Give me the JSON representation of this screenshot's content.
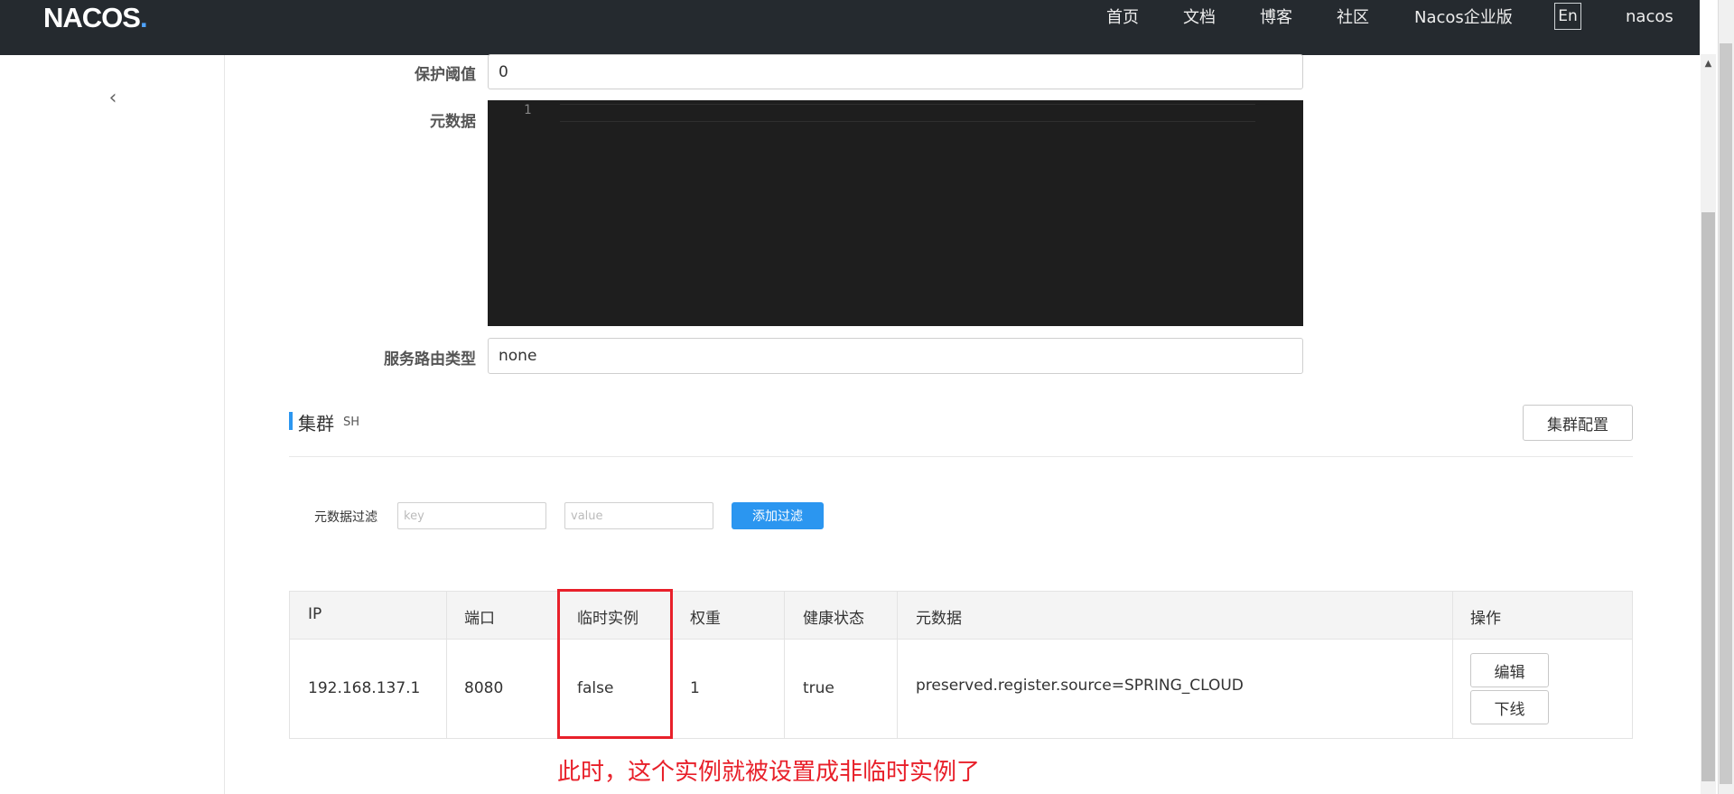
{
  "header": {
    "logo_text": "NACOS",
    "logo_dot": ".",
    "nav": [
      "首页",
      "文档",
      "博客",
      "社区",
      "Nacos企业版"
    ],
    "language_button": "En",
    "user": "nacos"
  },
  "service_form": {
    "protect_threshold_label": "保护阈值",
    "protect_threshold_value": "0",
    "metadata_label": "元数据",
    "editor_line_number": "1",
    "routing_type_label": "服务路由类型",
    "routing_type_value": "none"
  },
  "cluster": {
    "title": "集群",
    "name": "SH",
    "config_button": "集群配置",
    "filter_label": "元数据过滤",
    "key_placeholder": "key",
    "value_placeholder": "value",
    "add_filter_button": "添加过滤"
  },
  "instance_table": {
    "columns": [
      "IP",
      "端口",
      "临时实例",
      "权重",
      "健康状态",
      "元数据",
      "操作"
    ],
    "rows": [
      {
        "ip": "192.168.137.1",
        "port": "8080",
        "ephemeral": "false",
        "weight": "1",
        "healthy": "true",
        "metadata": "preserved.register.source=SPRING_CLOUD",
        "edit_button": "编辑",
        "offline_button": "下线"
      }
    ]
  },
  "annotation": {
    "text": "此时，这个实例就被设置成非临时实例了",
    "color": "#e8202a"
  },
  "colors": {
    "header_bg": "#252a2f",
    "primary": "#2b96f0",
    "editor_bg": "#1e1e1e"
  }
}
